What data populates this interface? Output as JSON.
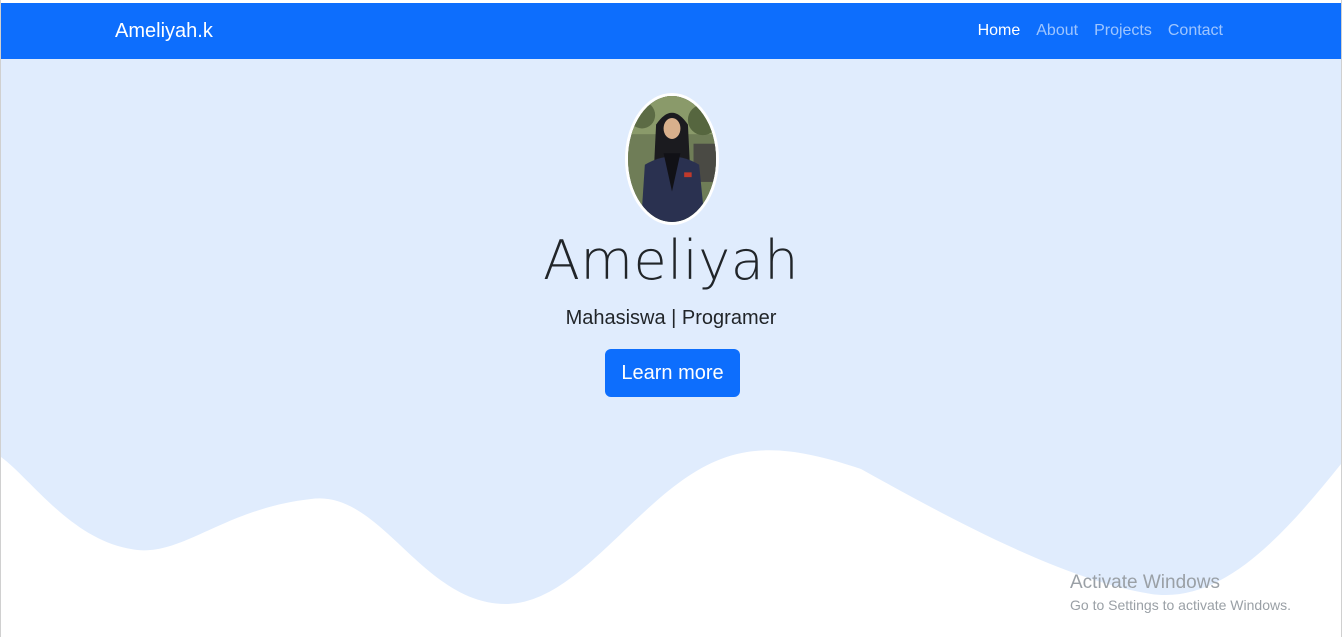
{
  "navbar": {
    "brand": "Ameliyah.k",
    "links": [
      {
        "label": "Home",
        "active": true
      },
      {
        "label": "About",
        "active": false
      },
      {
        "label": "Projects",
        "active": false
      },
      {
        "label": "Contact",
        "active": false
      }
    ]
  },
  "hero": {
    "name": "Ameliyah",
    "tagline": "Mahasiswa | Programer",
    "button_label": "Learn more"
  },
  "watermark": {
    "title": "Activate Windows",
    "subtitle": "Go to Settings to activate Windows."
  },
  "colors": {
    "primary": "#0d6efd",
    "hero_bg": "#e0ecfd",
    "white": "#ffffff"
  }
}
